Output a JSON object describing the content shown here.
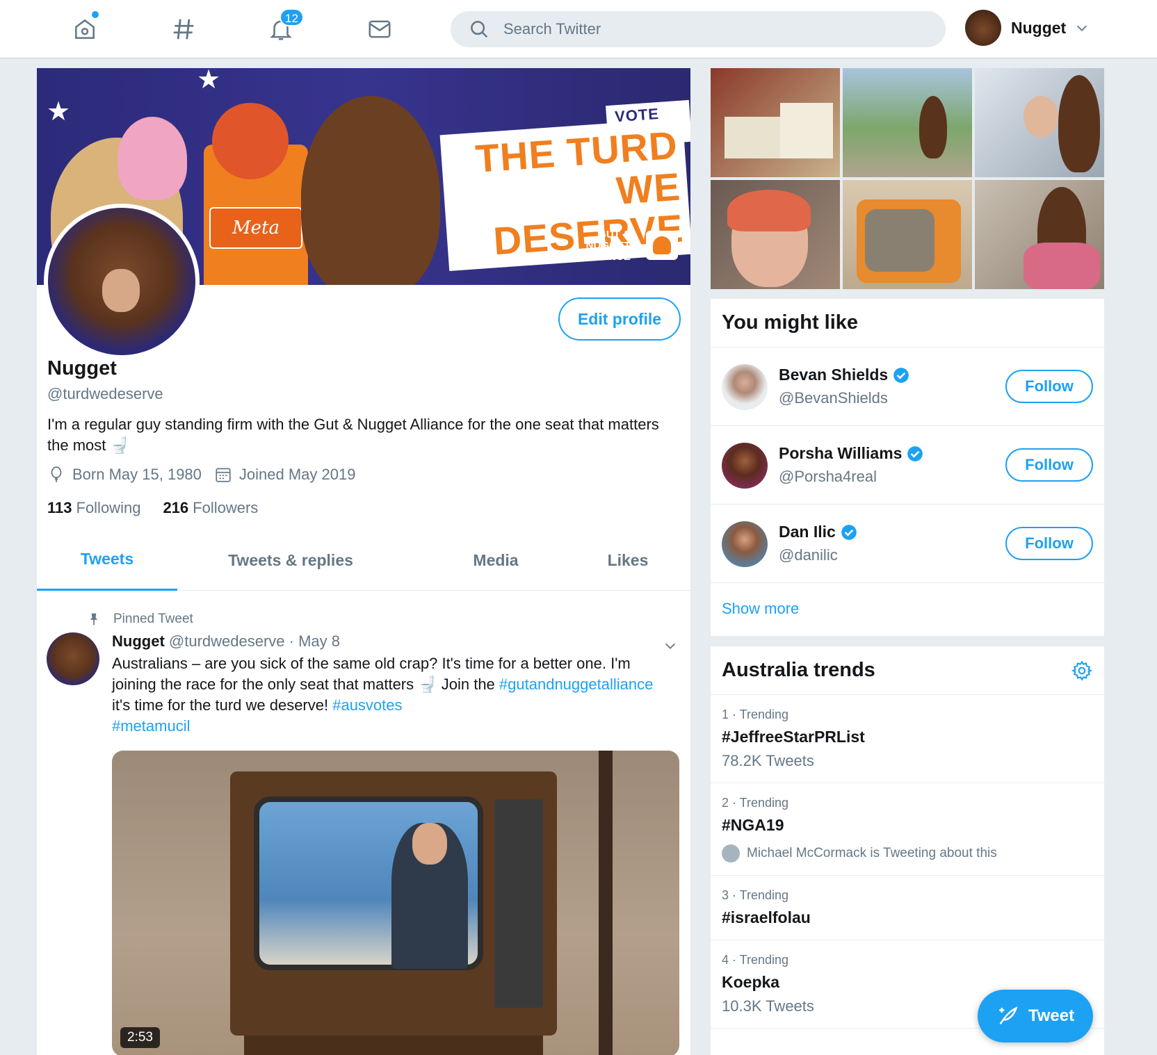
{
  "nav": {
    "notifications_count": "12",
    "search_placeholder": "Search Twitter",
    "account_name": "Nugget"
  },
  "banner": {
    "vote_for": "VOTE FOR",
    "headline_line1": "THE TURD",
    "headline_line2": "WE DESERVE",
    "alliance_line1": "GUT &",
    "alliance_line2": "NUGGET",
    "alliance_line3": "ALLIANCE",
    "jar_label": "Meta"
  },
  "profile": {
    "edit_label": "Edit profile",
    "name": "Nugget",
    "handle": "@turdwedeserve",
    "bio": "I'm a regular guy standing firm with the Gut & Nugget Alliance for the one seat that matters the most 🚽",
    "born": "Born May 15, 1980",
    "joined": "Joined May 2019",
    "following_count": "113",
    "following_label": "Following",
    "followers_count": "216",
    "followers_label": "Followers"
  },
  "tabs": [
    {
      "label": "Tweets"
    },
    {
      "label": "Tweets & replies"
    },
    {
      "label": "Media"
    },
    {
      "label": "Likes"
    }
  ],
  "pinned": {
    "label": "Pinned Tweet",
    "name": "Nugget",
    "handle": "@turdwedeserve",
    "date": "· May 8",
    "text_part1": "Australians – are you sick of the same old crap? It's time for a better one. I'm joining the race for the only seat that matters 🚽 Join the ",
    "tag1": "#gutandnuggetalliance",
    "text_part2": " it's time for the turd we deserve! ",
    "tag2": "#ausvotes",
    "tag3": "#metamucil",
    "duration": "2:53"
  },
  "you_might_like": {
    "title": "You might like",
    "users": [
      {
        "name": "Bevan Shields",
        "handle": "@BevanShields",
        "follow": "Follow"
      },
      {
        "name": "Porsha Williams",
        "handle": "@Porsha4real",
        "follow": "Follow"
      },
      {
        "name": "Dan Ilic",
        "handle": "@danilic",
        "follow": "Follow"
      }
    ],
    "show_more": "Show more"
  },
  "trends": {
    "title": "Australia trends",
    "items": [
      {
        "meta": "1 · Trending",
        "tag": "#JeffreeStarPRList",
        "count": "78.2K Tweets"
      },
      {
        "meta": "2 · Trending",
        "tag": "#NGA19",
        "context": "Michael McCormack is Tweeting about this"
      },
      {
        "meta": "3 · Trending",
        "tag": "#israelfolau"
      },
      {
        "meta": "4 · Trending",
        "tag": "Koepka",
        "count": "10.3K Tweets"
      }
    ]
  },
  "fab": {
    "label": "Tweet"
  },
  "colors": {
    "accent": "#1da1f2",
    "banner_blue": "#2c2a7a",
    "banner_orange": "#f07f1f"
  }
}
